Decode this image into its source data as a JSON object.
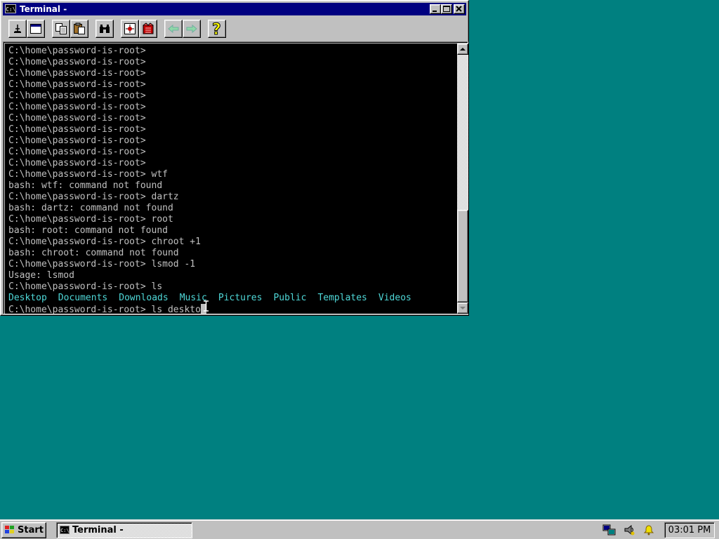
{
  "window": {
    "title": "Terminal -",
    "icon_text": "C:\\",
    "buttons": {
      "minimize": "minimize",
      "maximize": "maximize",
      "close": "close"
    }
  },
  "toolbar": {
    "tools": [
      {
        "name": "mark-tool",
        "icon": "mark-icon"
      },
      {
        "name": "fullscreen-tool",
        "icon": "window-icon"
      },
      {
        "name": "copy-tool",
        "icon": "copy-icon"
      },
      {
        "name": "paste-tool",
        "icon": "paste-icon"
      },
      {
        "name": "find-tool",
        "icon": "binoculars-icon"
      },
      {
        "name": "properties-tool",
        "icon": "properties-icon"
      },
      {
        "name": "background-tool",
        "icon": "background-icon"
      },
      {
        "name": "back-tool",
        "icon": "arrow-left-icon"
      },
      {
        "name": "forward-tool",
        "icon": "arrow-right-icon"
      },
      {
        "name": "help-tool",
        "icon": "help-icon"
      }
    ]
  },
  "console": {
    "lines": [
      "C:\\home\\password-is-root>",
      "C:\\home\\password-is-root>",
      "C:\\home\\password-is-root>",
      "C:\\home\\password-is-root>",
      "C:\\home\\password-is-root>",
      "C:\\home\\password-is-root>",
      "C:\\home\\password-is-root>",
      "C:\\home\\password-is-root>",
      "C:\\home\\password-is-root>",
      "C:\\home\\password-is-root>",
      "C:\\home\\password-is-root>",
      "C:\\home\\password-is-root> wtf",
      "bash: wtf: command not found",
      "C:\\home\\password-is-root> dartz",
      "bash: dartz: command not found",
      "C:\\home\\password-is-root> root",
      "bash: root: command not found",
      "C:\\home\\password-is-root> chroot +1",
      "bash: chroot: command not found",
      "C:\\home\\password-is-root> lsmod -1",
      "Usage: lsmod",
      "C:\\home\\password-is-root> ls"
    ],
    "ls_output": [
      "Desktop",
      "Documents",
      "Downloads",
      "Music",
      "Pictures",
      "Public",
      "Templates",
      "Videos"
    ],
    "current_input": "C:\\home\\password-is-root> ls deskto",
    "colors": {
      "background": "#000000",
      "text": "#c0c0c0",
      "directory": "#4fd8d8"
    }
  },
  "taskbar": {
    "start_label": "Start",
    "task_label": "Terminal -",
    "task_icon_text": "C:\\",
    "tray_icons": [
      "network-icon",
      "volume-icon",
      "notification-bell-icon"
    ],
    "clock": "03:01 PM"
  },
  "colors": {
    "desktop": "#008080",
    "titlebar": "#000080",
    "face": "#c0c0c0"
  }
}
